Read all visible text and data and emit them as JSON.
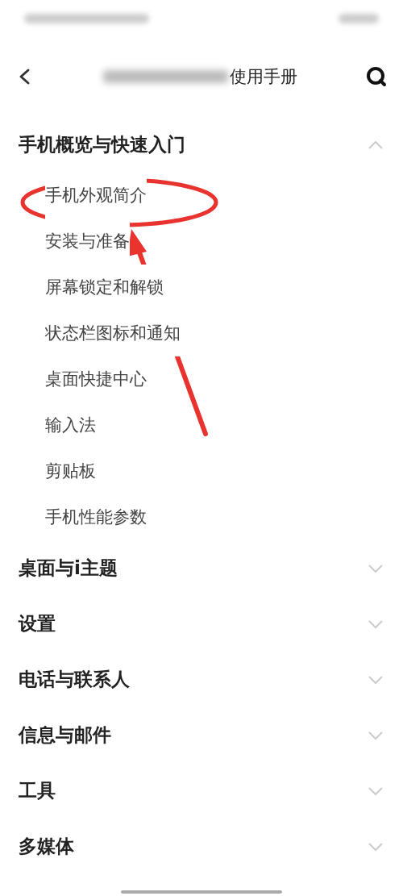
{
  "header": {
    "title": "使用手册"
  },
  "sections": [
    {
      "title": "手机概览与快速入门",
      "expanded": true,
      "children": [
        {
          "title": "手机外观简介"
        },
        {
          "title": "安装与准备"
        },
        {
          "title": "屏幕锁定和解锁"
        },
        {
          "title": "状态栏图标和通知"
        },
        {
          "title": "桌面快捷中心"
        },
        {
          "title": "输入法"
        },
        {
          "title": "剪贴板"
        },
        {
          "title": "手机性能参数"
        }
      ]
    },
    {
      "title": "桌面与i主题",
      "expanded": false
    },
    {
      "title": "设置",
      "expanded": false
    },
    {
      "title": "电话与联系人",
      "expanded": false
    },
    {
      "title": "信息与邮件",
      "expanded": false
    },
    {
      "title": "工具",
      "expanded": false
    },
    {
      "title": "多媒体",
      "expanded": false
    }
  ]
}
